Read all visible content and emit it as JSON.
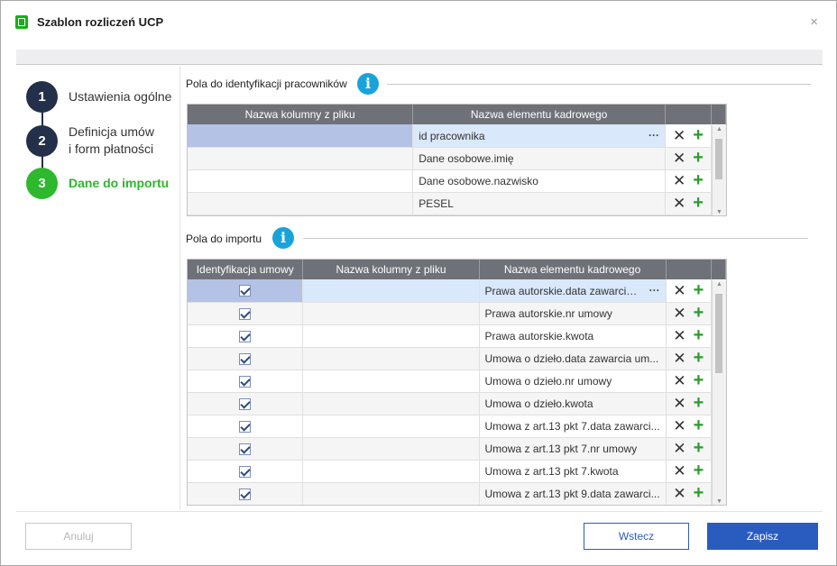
{
  "window": {
    "title": "Szablon rozliczeń UCP"
  },
  "steps": [
    {
      "number": "1",
      "label": "Ustawienia ogólne"
    },
    {
      "number": "2",
      "label_line1": "Definicja umów",
      "label_line2": "i form płatności"
    },
    {
      "number": "3",
      "label": "Dane do importu"
    }
  ],
  "section1": {
    "title": "Pola do identyfikacji pracowników",
    "headers": [
      "Nazwa kolumny z pliku",
      "Nazwa elementu kadrowego"
    ],
    "rows": [
      {
        "column": "",
        "element": "id pracownika"
      },
      {
        "column": "",
        "element": "Dane osobowe.imię"
      },
      {
        "column": "",
        "element": "Dane osobowe.nazwisko"
      },
      {
        "column": "",
        "element": "PESEL"
      }
    ]
  },
  "section2": {
    "title": "Pola do importu",
    "headers": [
      "Identyfikacja umowy",
      "Nazwa kolumny z pliku",
      "Nazwa elementu kadrowego"
    ],
    "rows": [
      {
        "checked": true,
        "column": "",
        "element": "Prawa autorskie.data zawarcia..."
      },
      {
        "checked": true,
        "column": "",
        "element": "Prawa autorskie.nr umowy"
      },
      {
        "checked": true,
        "column": "",
        "element": "Prawa autorskie.kwota"
      },
      {
        "checked": true,
        "column": "",
        "element": "Umowa o dzieło.data zawarcia um..."
      },
      {
        "checked": true,
        "column": "",
        "element": "Umowa o dzieło.nr umowy"
      },
      {
        "checked": true,
        "column": "",
        "element": "Umowa o dzieło.kwota"
      },
      {
        "checked": true,
        "column": "",
        "element": "Umowa z art.13 pkt 7.data zawarci..."
      },
      {
        "checked": true,
        "column": "",
        "element": "Umowa z art.13 pkt 7.nr umowy"
      },
      {
        "checked": true,
        "column": "",
        "element": "Umowa z art.13 pkt 7.kwota"
      },
      {
        "checked": true,
        "column": "",
        "element": "Umowa z art.13 pkt 9.data zawarci..."
      }
    ]
  },
  "icons": {
    "info": "i",
    "remove": "✕",
    "add": "+",
    "more": "···",
    "close": "×"
  },
  "footer": {
    "cancel": "Anuluj",
    "back": "Wstecz",
    "save": "Zapisz"
  }
}
